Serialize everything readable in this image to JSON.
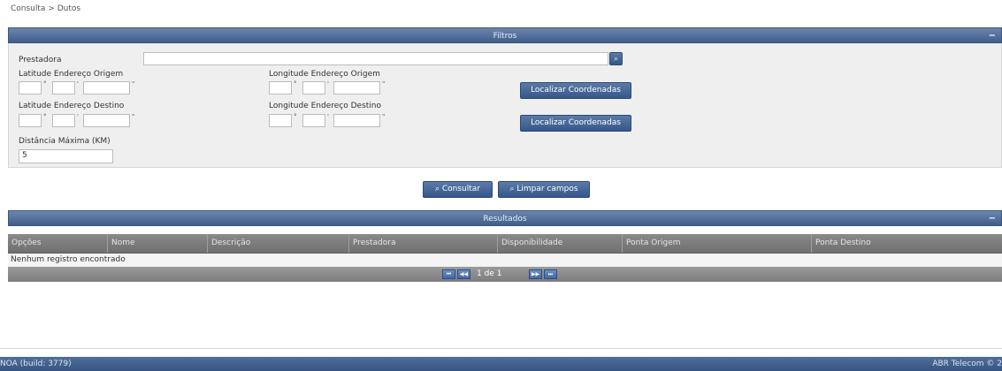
{
  "breadcrumb": "Consulta >  Dutos",
  "filters": {
    "title": "Filtros",
    "toggle": "−",
    "prestadora_label": "Prestadora",
    "prestadora_value": "",
    "lat_origem_label": "Latitude Endereço Origem",
    "lon_origem_label": "Longitude Endereço Origem",
    "lat_destino_label": "Latitude Endereço Destino",
    "lon_destino_label": "Longitude Endereço Destino",
    "localizar_label": "Localizar Coordenadas",
    "distancia_label": "Distância Máxima (KM)",
    "distancia_value": "5",
    "deg_symbol": "°",
    "min_symbol": "'",
    "sec_symbol": "\""
  },
  "actions": {
    "consultar": "⌕ Consultar",
    "limpar": "⌕ Limpar campos"
  },
  "results": {
    "title": "Resultados",
    "toggle": "−",
    "columns": [
      "Opções",
      "Nome",
      "Descrição",
      "Prestadora",
      "Disponibilidade",
      "Ponta Origem",
      "Ponta Destino"
    ],
    "empty_message": "Nenhum registro encontrado",
    "pagination": "1 de 1"
  },
  "footer": {
    "left": "NOA (build: 3779)",
    "right": "ABR Telecom © 2"
  },
  "icons": {
    "search": "⌕",
    "first": "⏮",
    "prev": "◀◀",
    "next": "▶▶",
    "last": "⏭"
  },
  "colors": {
    "header_blue": "#3f5e8c",
    "button_blue": "#35578a",
    "table_header_gray": "#7a7a7a"
  }
}
